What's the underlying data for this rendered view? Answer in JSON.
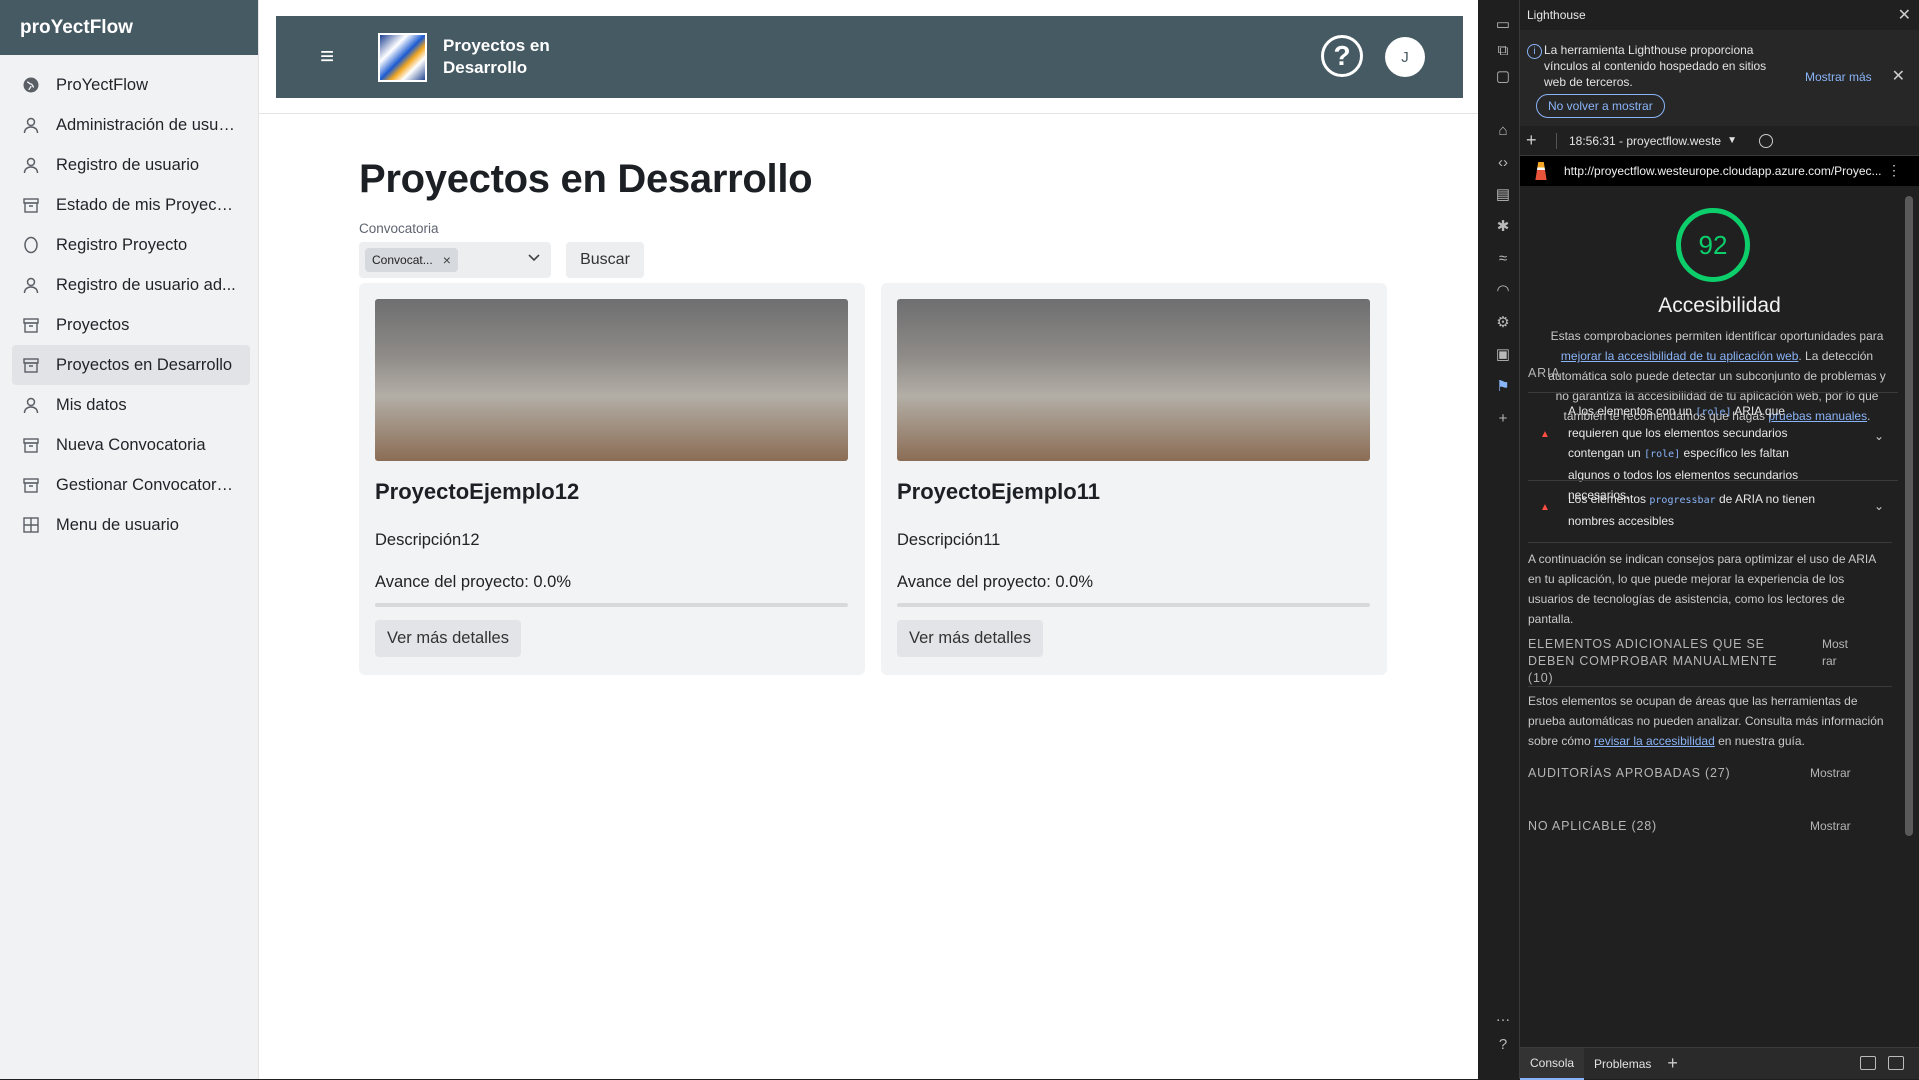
{
  "sidebar": {
    "brand": "proYectFlow",
    "items": [
      {
        "label": "ProYectFlow",
        "icon": "globe-icon"
      },
      {
        "label": "Administración de usua...",
        "icon": "user-icon"
      },
      {
        "label": "Registro de usuario",
        "icon": "user-icon"
      },
      {
        "label": "Estado de mis Proyectos",
        "icon": "archive-icon"
      },
      {
        "label": "Registro Proyecto",
        "icon": "circle-icon"
      },
      {
        "label": "Registro de usuario ad...",
        "icon": "user-icon"
      },
      {
        "label": "Proyectos",
        "icon": "archive-icon"
      },
      {
        "label": "Proyectos en Desarrollo",
        "icon": "archive-icon",
        "active": true
      },
      {
        "label": "Mis datos",
        "icon": "user-icon"
      },
      {
        "label": "Nueva Convocatoria",
        "icon": "archive-icon"
      },
      {
        "label": "Gestionar Convocatorias",
        "icon": "archive-icon"
      },
      {
        "label": "Menu de usuario",
        "icon": "grid-icon"
      }
    ]
  },
  "header": {
    "title": "Proyectos en Desarrollo",
    "avatar_initial": "J",
    "help_symbol": "?",
    "menu_symbol": "≡"
  },
  "main": {
    "page_title": "Proyectos en Desarrollo",
    "convocatoria_label": "Convocatoria",
    "convocatoria_chip": "Convocat...",
    "search_button": "Buscar",
    "cards": [
      {
        "name": "ProyectoEjemplo12",
        "description": "Descripción12",
        "progress_text": "Avance del proyecto: 0.0%",
        "progress": 0,
        "button": "Ver más detalles"
      },
      {
        "name": "ProyectoEjemplo11",
        "description": "Descripción11",
        "progress_text": "Avance del proyecto: 0.0%",
        "progress": 0,
        "button": "Ver más detalles"
      }
    ]
  },
  "devtools": {
    "panel_title": "Lighthouse",
    "info_text": "La herramienta Lighthouse proporciona vínculos al contenido hospedado en sitios web de terceros.",
    "show_more": "Mostrar más",
    "dont_show": "No volver a mostrar",
    "session": "18:56:31 - proyectflow.weste",
    "url": "http://proyectflow.westeurope.cloudapp.azure.com/Proyec...",
    "score": "92",
    "category": "Accesibilidad",
    "desc_1": "Estas comprobaciones permiten identificar oportunidades para",
    "desc_link1": "mejorar la accesibilidad de tu aplicación web",
    "desc_2": ". La detección automática solo puede detectar un subconjunto de problemas y no garantiza la accesibilidad de tu aplicación web, por lo que también te recomendamos que hagas",
    "desc_link2": "pruebas manuales",
    "aria_section": "ARIA",
    "audit1_a": "A los elementos con un",
    "audit1_code1": "[role]",
    "audit1_b": "ARIA que requieren que los elementos secundarios contengan un",
    "audit1_code2": "[role]",
    "audit1_c": "específico les faltan algunos o todos los elementos secundarios necesarios.",
    "audit2_a": "Los elementos",
    "audit2_code": "progressbar",
    "audit2_b": "de ARIA no tienen nombres accesibles",
    "aria_tip": "A continuación se indican consejos para optimizar el uso de ARIA en tu aplicación, lo que puede mejorar la experiencia de los usuarios de tecnologías de asistencia, como los lectores de pantalla.",
    "manual_section": "ELEMENTOS ADICIONALES QUE SE DEBEN COMPROBAR MANUALMENTE (10)",
    "manual_toggle": "Mostrar",
    "manual_a": "Estos elementos se ocupan de áreas que las herramientas de prueba automáticas no pueden analizar. Consulta más información sobre cómo",
    "manual_link": "revisar la accesibilidad",
    "manual_b": "en nuestra guía.",
    "passed_section": "AUDITORÍAS APROBADAS (27)",
    "passed_toggle": "Mostrar",
    "na_section": "NO APLICABLE (28)",
    "na_toggle": "Mostrar",
    "bottom_tabs": [
      "Consola",
      "Problemas"
    ]
  }
}
